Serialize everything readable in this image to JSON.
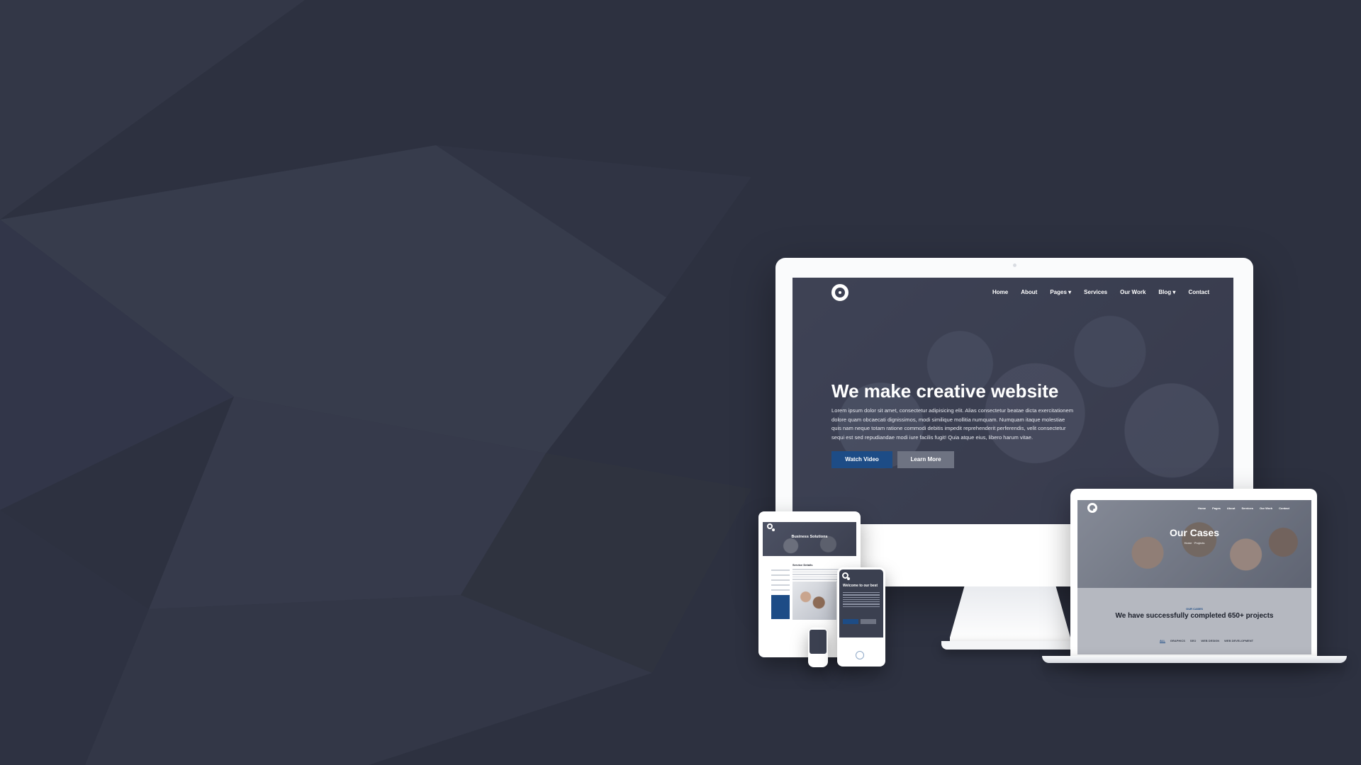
{
  "imac": {
    "nav": [
      "Home",
      "About",
      "Pages",
      "Services",
      "Our Work",
      "Blog",
      "Contact"
    ],
    "hero_title": "We make creative website",
    "hero_text": "Lorem ipsum dolor sit amet, consectetur adipisicing elit. Alias consectetur beatae dicta exercitationem dolore quam obcaecati dignissimos, modi similique mollitia numquam. Numquam itaque molestiae quis nam neque totam ratione commodi debitis impedit reprehenderit perferendis, velit consectetur sequi est sed repudiandae modi iure facilis fugit! Quia atque eius, libero harum vitae.",
    "primary_button": "Watch Video",
    "secondary_button": "Learn More"
  },
  "laptop": {
    "nav": [
      "Home",
      "Pages",
      "About",
      "Services",
      "Our Work",
      "Contact"
    ],
    "hero_title": "Our Cases",
    "breadcrumb": "Home · Projects",
    "subheading": "OUR CASES",
    "heading": "We have successfully completed 650+ projects",
    "filters": [
      "ALL",
      "GRAPHICS",
      "SEO",
      "WEB DESIGN",
      "WEB DEVELOPMENT"
    ]
  },
  "tablet": {
    "hero_title": "Business Solutions",
    "section_title": "Service Details"
  },
  "phone": {
    "hero_title": "Welcome to our best"
  },
  "colors": {
    "background": "#2d3140",
    "accent": "#1d4c86",
    "secondary_button": "#6e7382"
  }
}
